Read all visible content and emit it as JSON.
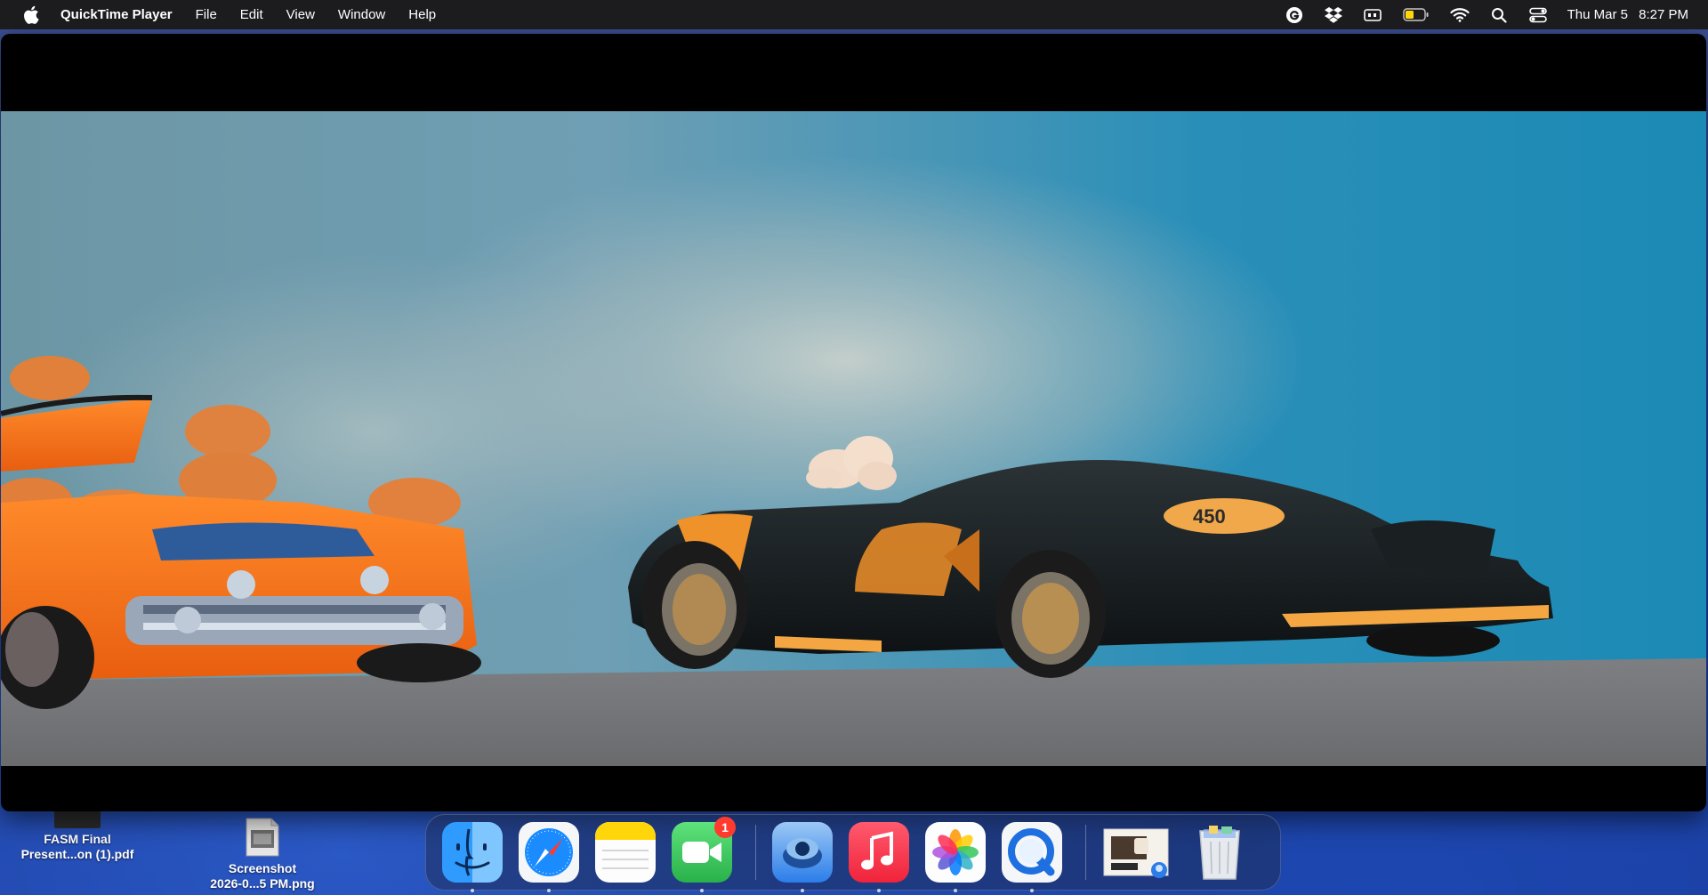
{
  "menubar": {
    "app_name": "QuickTime Player",
    "menus": [
      "File",
      "Edit",
      "View",
      "Window",
      "Help"
    ],
    "clock_date": "Thu Mar 5",
    "clock_time": "8:27 PM",
    "status_icons": [
      "grammarly-icon",
      "dropbox-icon",
      "keyboard-input-icon",
      "battery-icon",
      "wifi-icon",
      "spotlight-search-icon",
      "control-center-icon"
    ],
    "battery_level": 0.45
  },
  "window": {
    "content": "video-frame",
    "video_description_icon": "toy-cars-scene"
  },
  "desktop_files": [
    {
      "name_line1": "FASM Final",
      "name_line2": "Present...on (1).pdf"
    },
    {
      "name_line1": "Screenshot",
      "name_line2": "2026-0...5 PM.png"
    }
  ],
  "dock": {
    "apps": [
      {
        "name": "Finder",
        "icon": "finder-icon"
      },
      {
        "name": "Safari",
        "icon": "safari-icon"
      },
      {
        "name": "Notes",
        "icon": "notes-icon"
      },
      {
        "name": "FaceTime",
        "icon": "facetime-icon",
        "badge": "1"
      },
      {
        "name": "Preview",
        "icon": "preview-icon"
      },
      {
        "name": "Music",
        "icon": "music-icon"
      },
      {
        "name": "Photos",
        "icon": "photos-icon"
      },
      {
        "name": "QuickTime Player",
        "icon": "quicktime-icon"
      }
    ],
    "right_items": [
      {
        "name": "Recent document",
        "icon": "document-stack-icon"
      },
      {
        "name": "Trash",
        "icon": "trash-icon"
      }
    ],
    "colors": {
      "finder": "#1e90ff",
      "safari": "#1a8cff",
      "notes": "#ffd60a",
      "facetime": "#34c759",
      "preview": "#2b7de9",
      "music": "#fa243c",
      "quicktime": "#1e6fe0"
    }
  }
}
